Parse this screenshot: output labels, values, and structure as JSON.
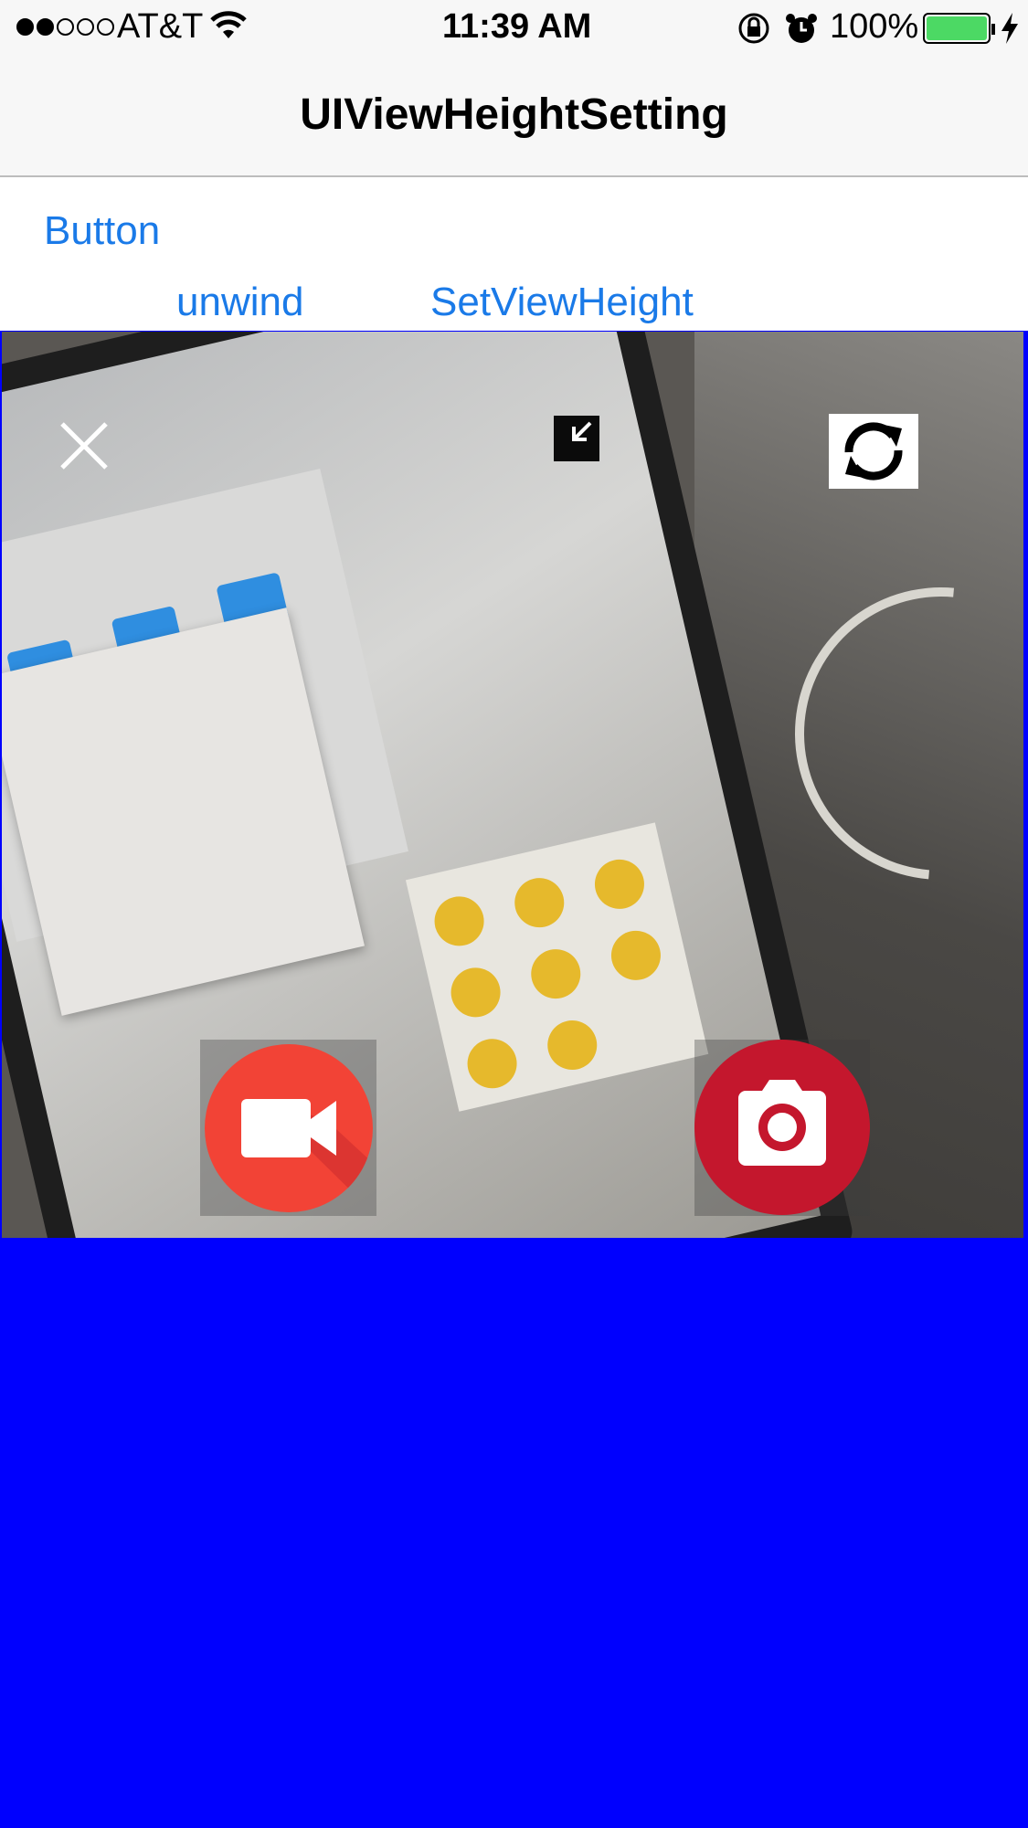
{
  "status_bar": {
    "carrier": "AT&T",
    "time": "11:39 AM",
    "battery_percent": "100%",
    "signal_bars_filled": 2,
    "signal_bars_total": 5,
    "icons": [
      "wifi-icon",
      "rotation-lock-icon",
      "alarm-icon",
      "battery-icon",
      "charging-icon"
    ]
  },
  "nav": {
    "title": "UIViewHeightSetting"
  },
  "content": {
    "button_label": "Button",
    "unwind_label": "unwind",
    "set_view_height_label": "SetViewHeight"
  },
  "camera": {
    "controls": [
      "close-icon",
      "collapse-icon",
      "switch-camera-icon",
      "video-record-icon",
      "camera-shutter-icon"
    ]
  },
  "colors": {
    "link": "#1a7ae8",
    "background": "#0000fe",
    "record": "#f24336",
    "shutter": "#c4172d"
  }
}
